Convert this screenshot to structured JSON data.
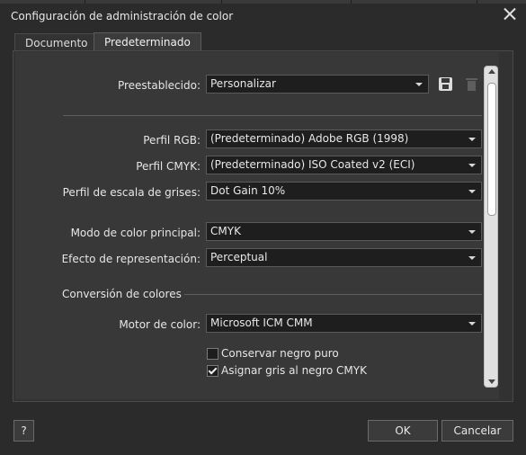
{
  "window": {
    "title": "Configuración de administración de color"
  },
  "tabs": [
    {
      "label": "Documento",
      "active": false
    },
    {
      "label": "Predeterminado",
      "active": true
    }
  ],
  "preset": {
    "label": "Preestablecido:",
    "value": "Personalizar",
    "save_icon": "save-icon",
    "delete_icon": "trash-icon"
  },
  "profiles": {
    "rgb": {
      "label": "Perfil RGB:",
      "value": "(Predeterminado) Adobe RGB (1998)"
    },
    "cmyk": {
      "label": "Perfil CMYK:",
      "value": "(Predeterminado) ISO Coated v2 (ECI)"
    },
    "gray": {
      "label": "Perfil de escala de grises:",
      "value": "Dot Gain 10%"
    }
  },
  "mode": {
    "primary": {
      "label": "Modo de color principal:",
      "value": "CMYK"
    },
    "intent": {
      "label": "Efecto de representación:",
      "value": "Perceptual"
    }
  },
  "conversion": {
    "section_title": "Conversión de colores",
    "engine": {
      "label": "Motor de color:",
      "value": "Microsoft ICM CMM"
    },
    "options": [
      {
        "label": "Conservar negro puro",
        "checked": false
      },
      {
        "label": "Asignar gris al negro CMYK",
        "checked": true
      }
    ]
  },
  "buttons": {
    "help": "?",
    "ok": "OK",
    "cancel": "Cancelar"
  }
}
